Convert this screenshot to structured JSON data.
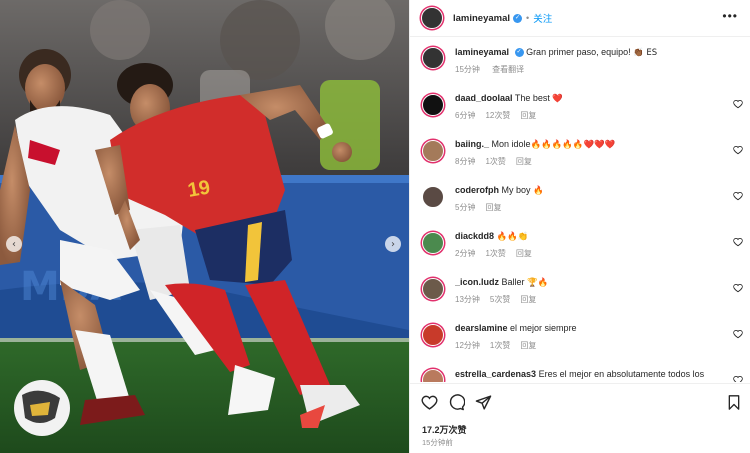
{
  "post": {
    "username": "lamineyamal",
    "verified_mark": "✓",
    "separator": "•",
    "follow_label": "关注",
    "more_label": "•••"
  },
  "caption": {
    "username": "lamineyamal",
    "text": "Gran primer paso, equipo!",
    "emoji": "👏🏾 ES",
    "time": "15分钟",
    "translate": "查看翻译"
  },
  "comments": [
    {
      "username": "daad_doolaal",
      "text": "The best",
      "emoji": "❤️",
      "time": "6分钟",
      "likes": "12次赞",
      "reply": "回复"
    },
    {
      "username": "baiing._",
      "text": "Mon idole",
      "emoji": "🔥🔥🔥🔥🔥❤️❤️❤️",
      "time": "8分钟",
      "likes": "1次赞",
      "reply": "回复"
    },
    {
      "username": "coderofph",
      "text": "My boy",
      "emoji": "🔥",
      "time": "5分钟",
      "likes": "",
      "reply": "回复"
    },
    {
      "username": "diackdd8",
      "text": "",
      "emoji": "🔥🔥👏",
      "time": "2分钟",
      "likes": "1次赞",
      "reply": "回复"
    },
    {
      "username": "_icon.ludz",
      "text": "Baller",
      "emoji": "🏆🔥",
      "time": "13分钟",
      "likes": "5次赞",
      "reply": "回复"
    },
    {
      "username": "dearslamine",
      "text": "el mejor siempre",
      "emoji": "",
      "time": "12分钟",
      "likes": "1次赞",
      "reply": "回复"
    },
    {
      "username": "estrella_cardenas3",
      "text": "Eres el mejor en absolutamente todos los",
      "emoji": "",
      "time": "",
      "likes": "",
      "reply": ""
    }
  ],
  "footer": {
    "likes": "17.2万次赞",
    "time": "15分钟前"
  },
  "media": {
    "jersey_number": "19",
    "carousel_prev": "‹",
    "carousel_next": "›"
  },
  "colors": {
    "accent": "#0095f6",
    "verified": "#3897f0",
    "heart": "#ed4956"
  }
}
